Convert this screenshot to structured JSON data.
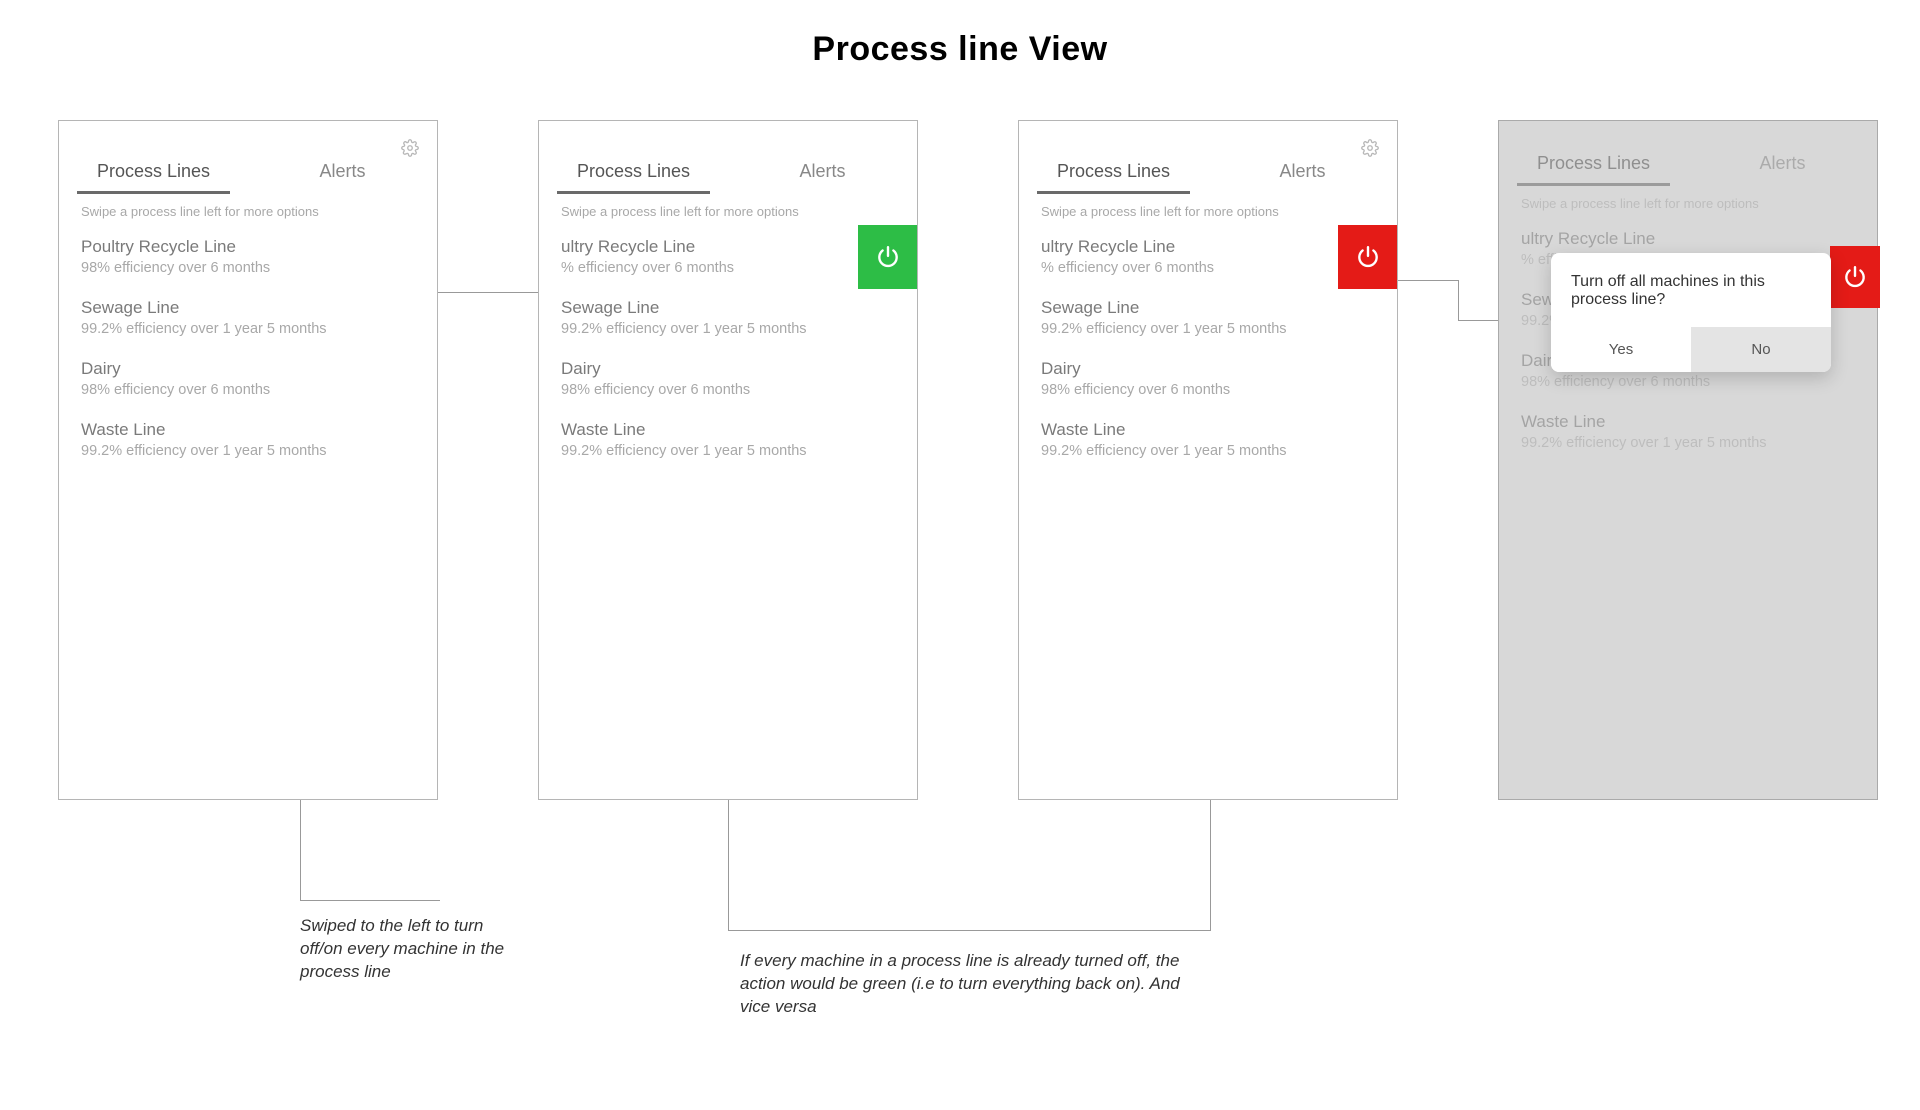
{
  "page_title": "Process line View",
  "tabs": {
    "process_lines": "Process Lines",
    "alerts": "Alerts"
  },
  "hint": "Swipe a process line left for more options",
  "lines": [
    {
      "name": "Poultry Recycle Line",
      "meta": "98% efficiency over 6 months"
    },
    {
      "name": "Sewage Line",
      "meta": "99.2% efficiency over 1 year 5 months"
    },
    {
      "name": "Dairy",
      "meta": "98% efficiency over 6 months"
    },
    {
      "name": "Waste Line",
      "meta": "99.2% efficiency over 1 year 5 months"
    }
  ],
  "swiped_first": {
    "name_clip": "ultry Recycle Line",
    "meta_clip": "% efficiency over 6 months"
  },
  "popup": {
    "message": "Turn off all machines in this process line?",
    "yes": "Yes",
    "no": "No"
  },
  "annotations": {
    "a1": "Swiped to the left to turn off/on every machine in the process line",
    "a2": "If every machine in a process line is already turned off, the action would be green (i.e to turn everything back on). And vice versa"
  },
  "colors": {
    "green": "#2dbd46",
    "red": "#e41b17"
  }
}
